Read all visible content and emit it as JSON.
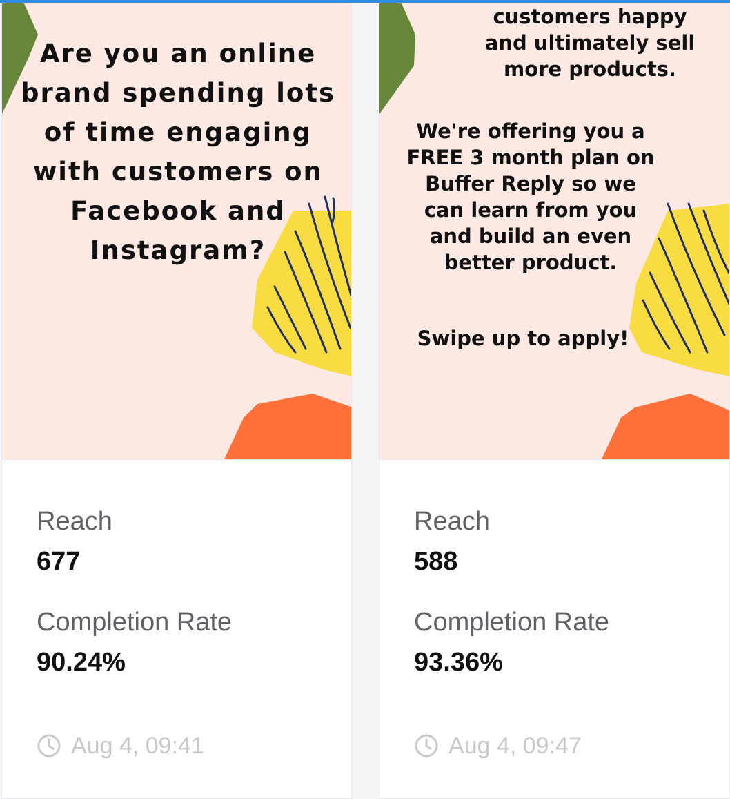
{
  "accent_color": "#2b8ee6",
  "stories": [
    {
      "text": "Are you an online\nbrand spending lots\nof time engaging\nwith customers on\nFacebook and\nInstagram?",
      "reach_label": "Reach",
      "reach_value": "677",
      "completion_label": "Completion Rate",
      "completion_value": "90.24%",
      "timestamp": "Aug 4, 09:41",
      "timestamp_icon": "clock-icon"
    },
    {
      "text_top": "customers happy\nand ultimately sell\nmore products.",
      "text_middle": "We're offering you a\nFREE 3 month plan on\nBuffer Reply so we\ncan learn from you\nand build an even\nbetter product.",
      "text_bottom": "Swipe up to apply!",
      "reach_label": "Reach",
      "reach_value": "588",
      "completion_label": "Completion Rate",
      "completion_value": "93.36%",
      "timestamp": "Aug 4, 09:47",
      "timestamp_icon": "clock-icon"
    }
  ],
  "story_colors": {
    "background": "#fde9e3",
    "green": "#66863a",
    "yellow": "#f9dc42",
    "orange": "#ff7139",
    "scribble": "#1f2f63"
  }
}
